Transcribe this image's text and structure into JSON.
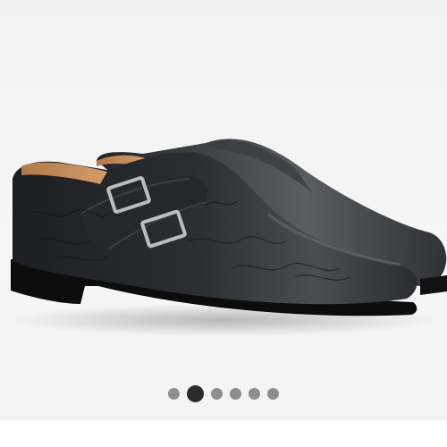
{
  "gallery": {
    "image": {
      "subject": "double-monk-strap-shoe-icon"
    },
    "carousel": {
      "total": 6,
      "active_index": 1
    }
  },
  "colors": {
    "background": "#f3f3f3",
    "dot_inactive": "#8e8e8e",
    "dot_active": "#2b2b2b"
  }
}
